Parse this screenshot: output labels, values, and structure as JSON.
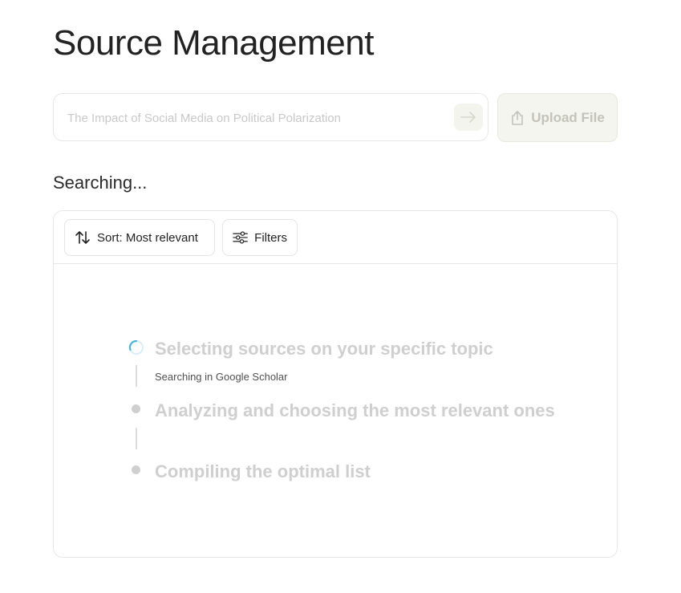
{
  "page": {
    "title": "Source Management"
  },
  "search": {
    "placeholder": "The Impact of Social Media on Political Polarization",
    "value": ""
  },
  "upload": {
    "label": "Upload File",
    "icon": "upload-icon"
  },
  "submit": {
    "icon": "arrow-right-icon"
  },
  "status": {
    "label": "Searching..."
  },
  "toolbar": {
    "sort_label": "Sort: Most relevant",
    "sort_icon": "sort-arrows-icon",
    "filters_label": "Filters",
    "filters_icon": "sliders-icon"
  },
  "steps": [
    {
      "title": "Selecting sources on your specific topic",
      "subtitle": "Searching in Google Scholar",
      "state": "in-progress"
    },
    {
      "title": "Analyzing and choosing the most relevant ones",
      "subtitle": "",
      "state": "pending"
    },
    {
      "title": "Compiling the optimal list",
      "subtitle": "",
      "state": "pending"
    }
  ],
  "colors": {
    "spinner": "#49b6e0",
    "pending": "#cfcfcf",
    "upload_bg": "#f4f5ef"
  }
}
